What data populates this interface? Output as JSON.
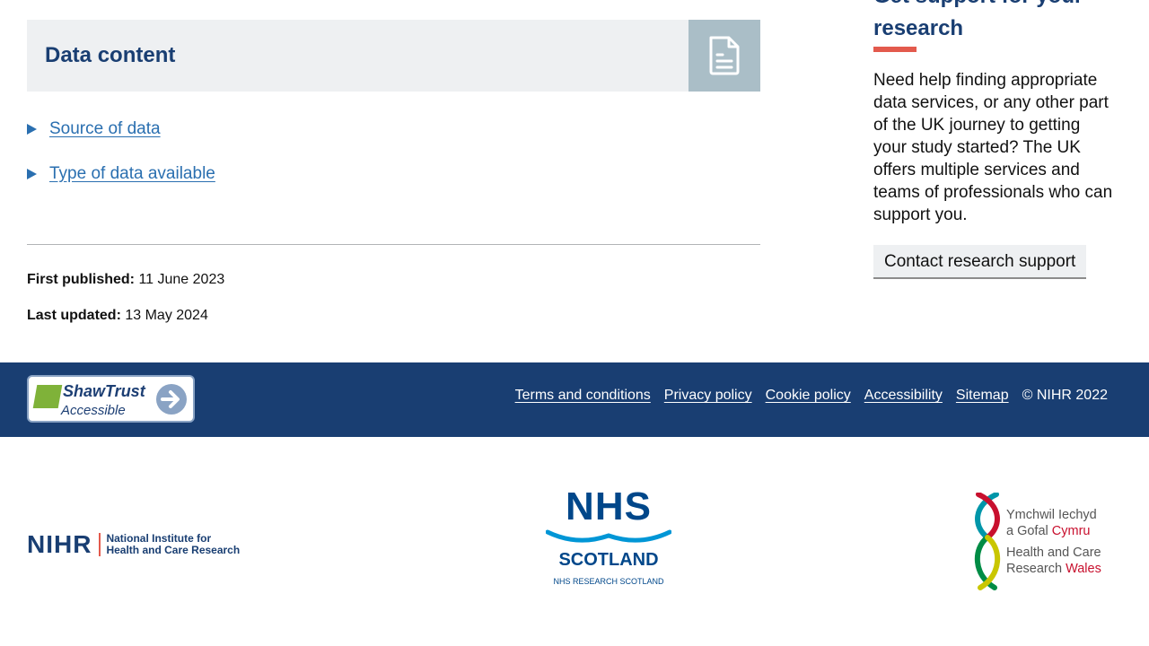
{
  "main": {
    "section_title": "Data content",
    "section_icon": "document-icon",
    "expanders": [
      {
        "label": "Source of data"
      },
      {
        "label": "Type of data available"
      }
    ],
    "first_published_label": "First published:",
    "first_published_value": "11 June 2023",
    "last_updated_label": "Last updated:",
    "last_updated_value": "13 May 2024"
  },
  "aside": {
    "title": "Get support for your research",
    "body": "Need help finding appropriate data services, or any other part of the UK journey to getting your study started? The UK offers multiple services and teams of professionals who can support you.",
    "button_label": "Contact research support"
  },
  "footer": {
    "badge_line1": "ShawTrust",
    "badge_line2": "Accessible",
    "links": [
      "Terms and conditions",
      "Privacy policy",
      "Cookie policy",
      "Accessibility",
      "Sitemap"
    ],
    "copyright": "© NIHR 2022"
  },
  "logos": {
    "nihr_short": "NIHR",
    "nihr_line1": "National Institute for",
    "nihr_line2": "Health and Care Research",
    "nhs_top": "NHS",
    "nhs_middle": "SCOTLAND",
    "nhs_bottom": "NHS RESEARCH SCOTLAND",
    "hcrw_line1": "Ymchwil Iechyd",
    "hcrw_line2a": "a Gofal ",
    "hcrw_line2b": "Cymru",
    "hcrw_line3": "Health and Care",
    "hcrw_line4a": "Research ",
    "hcrw_line4b": "Wales"
  },
  "colors": {
    "brand_navy": "#193e72",
    "accent_red": "#e35a4d",
    "link_blue": "#2a6fb0"
  }
}
